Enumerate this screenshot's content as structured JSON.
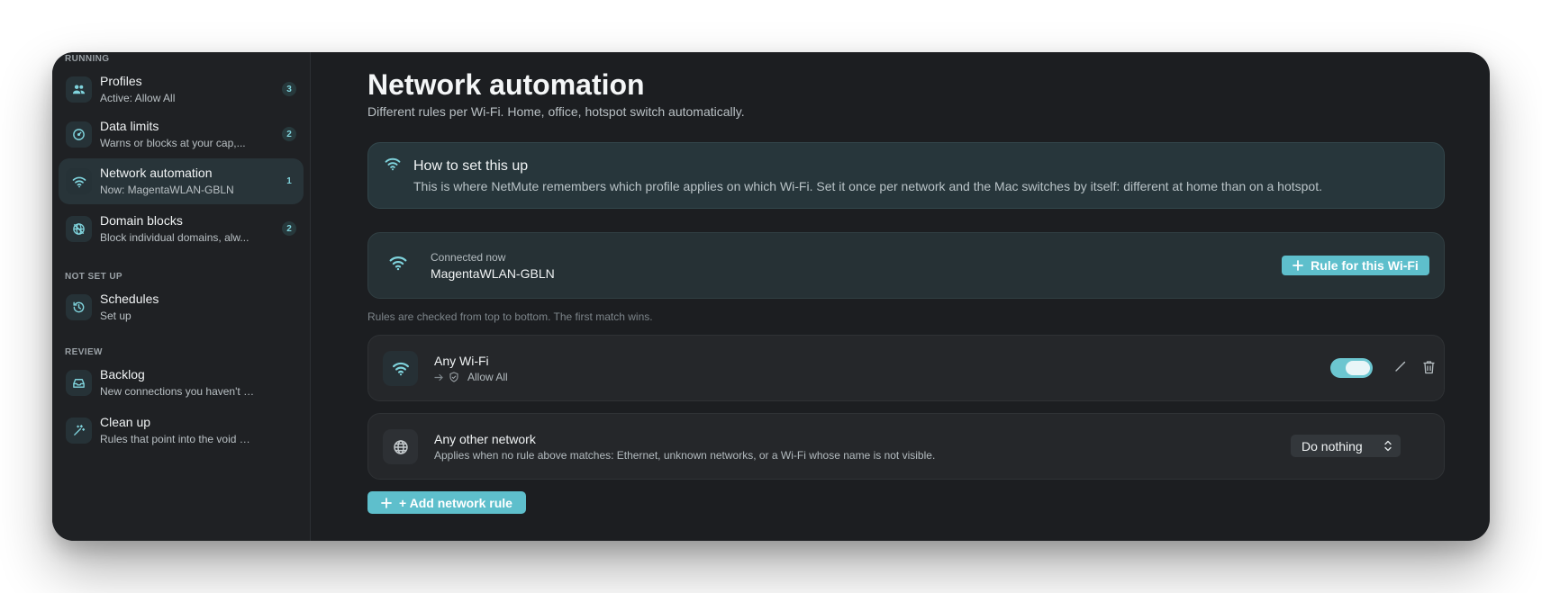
{
  "sidebar": {
    "sections": {
      "running": "RUNNING",
      "not_set_up": "NOT SET UP",
      "review": "REVIEW"
    },
    "items": [
      {
        "title": "Profiles",
        "subtitle": "Active: Allow All",
        "badge": "3",
        "icon": "people-icon"
      },
      {
        "title": "Data limits",
        "subtitle": "Warns or blocks at your cap,...",
        "badge": "2",
        "icon": "gauge-icon"
      },
      {
        "title": "Network automation",
        "subtitle": "Now: MagentaWLAN-GBLN",
        "badge": "1",
        "icon": "wifi-icon",
        "active": true
      },
      {
        "title": "Domain blocks",
        "subtitle": "Block individual domains, alw...",
        "badge": "2",
        "icon": "blocked-globe-icon"
      },
      {
        "title": "Schedules",
        "subtitle": "Set up",
        "icon": "history-icon"
      },
      {
        "title": "Backlog",
        "subtitle": "New connections you haven't dec...",
        "icon": "inbox-icon"
      },
      {
        "title": "Clean up",
        "subtitle": "Rules that point into the void or h...",
        "icon": "wand-icon"
      }
    ]
  },
  "main": {
    "title": "Network automation",
    "subtitle": "Different rules per Wi-Fi. Home, office, hotspot switch automatically.",
    "info": {
      "title": "How to set this up",
      "text": "This is where NetMute remembers which profile applies on which Wi-Fi. Set it once per network and the Mac switches by itself: different at home than on a hotspot."
    },
    "connection": {
      "label": "Connected now",
      "name": "MagentaWLAN-GBLN",
      "button": "Rule for this Wi-Fi"
    },
    "hint": "Rules are checked from top to bottom. The first match wins.",
    "rules": [
      {
        "title": "Any Wi-Fi",
        "profile": "Allow All",
        "enabled": true
      }
    ],
    "other": {
      "title": "Any other network",
      "subtitle": "Applies when no rule above matches: Ethernet, unknown networks, or a Wi-Fi whose name is not visible.",
      "select_value": "Do nothing"
    },
    "add_button": "+ Add network rule"
  },
  "colors": {
    "accent": "#5ebfcc",
    "window_bg": "#1c1e21",
    "sidebar_bg": "#1f2124",
    "active_item_bg": "#283439"
  }
}
